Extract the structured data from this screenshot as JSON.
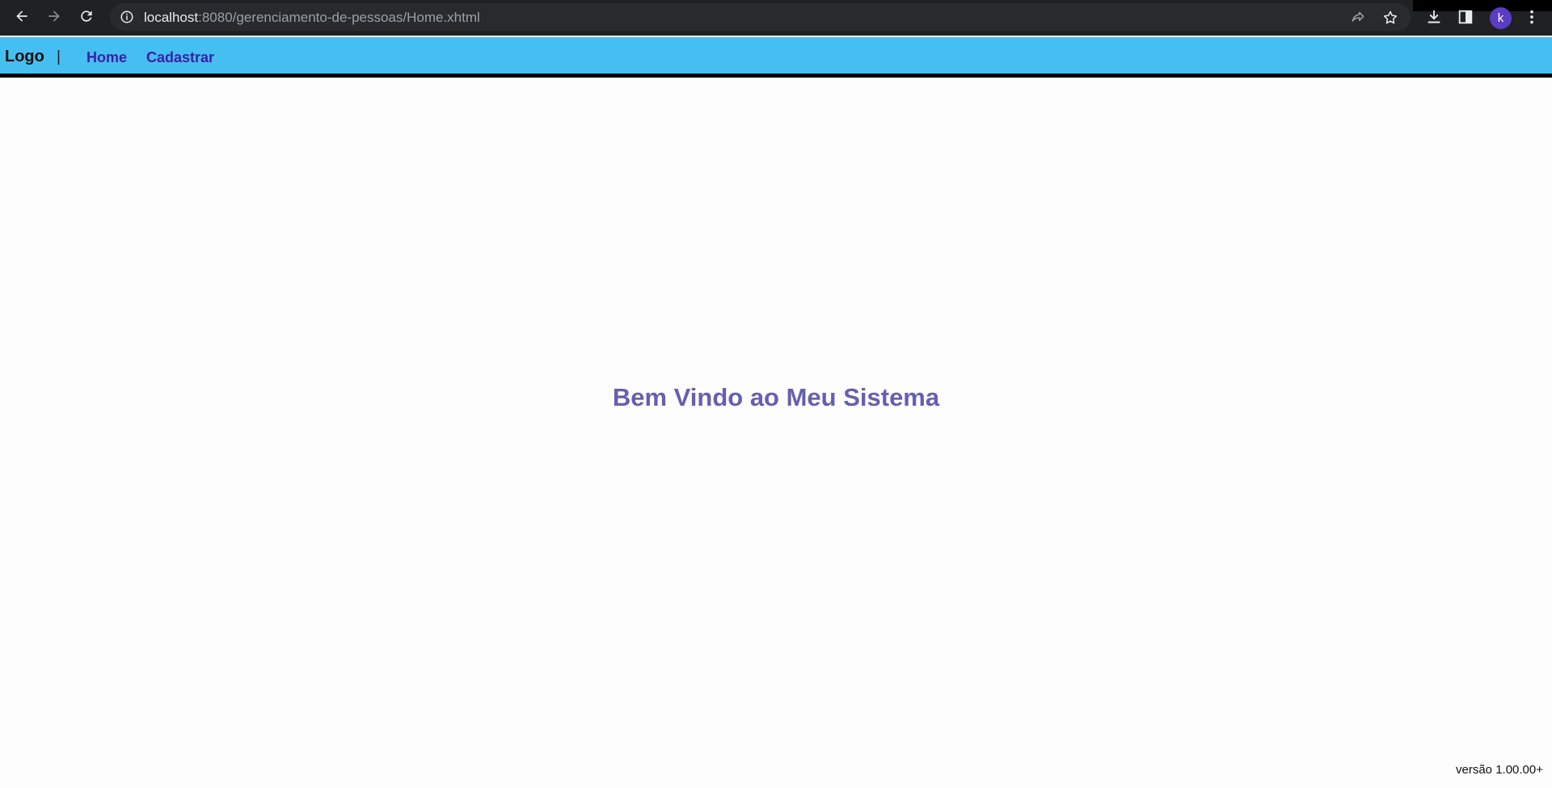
{
  "browser": {
    "url_host": "localhost",
    "url_path": ":8080/gerenciamento-de-pessoas/Home.xhtml",
    "avatar_letter": "k",
    "icons": [
      "back-arrow-icon",
      "forward-arrow-icon",
      "reload-icon",
      "info-icon",
      "share-icon",
      "star-icon",
      "download-icon",
      "side-panel-icon",
      "kebab-menu-icon"
    ]
  },
  "header": {
    "logo": "Logo",
    "separator": "|",
    "nav": [
      {
        "label": "Home"
      },
      {
        "label": "Cadastrar"
      }
    ]
  },
  "main": {
    "welcome": "Bem Vindo ao Meu Sistema"
  },
  "footer": {
    "version": "versão 1.00.00+"
  },
  "colors": {
    "header_bg": "#45bff2",
    "link": "#3b1fa8",
    "welcome": "#6560ad"
  }
}
